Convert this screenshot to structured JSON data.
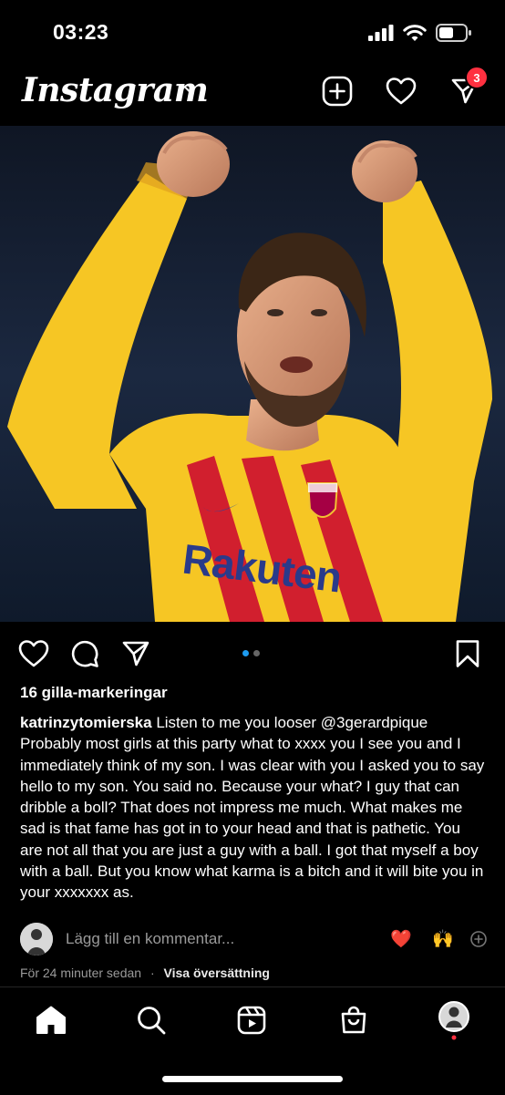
{
  "status_bar": {
    "time": "03:23"
  },
  "header": {
    "logo_text": "Instagram",
    "notification_count": "3"
  },
  "post": {
    "likes": "16 gilla-markeringar",
    "caption_user": "katrinzytomierska",
    "caption_text": "Listen to me you looser @3gerardpique Probably most girls at this party what to xxxx you I see you and I immediately think of my son. I was clear with you I asked you to say hello to my son. You said no. Because your what? I guy that can dribble a boll? That does not impress me much. What makes me sad is that fame has got in to your head and that is pathetic. You are not all that you are just a guy with a ball. I got that myself a boy with a ball. But you know what karma is a bitch and it will bite you in your xxxxxxx as.",
    "image_sponsor_text": "Rakuten",
    "carousel": {
      "total": 2,
      "active": 1
    },
    "comment_placeholder": "Lägg till en kommentar...",
    "quick_reactions": [
      "❤️",
      "🙌"
    ],
    "timestamp": "För 24 minuter sedan",
    "separator": "·",
    "translate_label": "Visa översättning"
  },
  "icons": {
    "header": [
      "new-post-icon",
      "heart-icon",
      "direct-message-icon"
    ],
    "actions": [
      "like-icon",
      "comment-icon",
      "share-icon",
      "save-icon"
    ],
    "nav": [
      "home-icon",
      "search-icon",
      "reels-icon",
      "shop-icon",
      "profile-avatar"
    ]
  },
  "colors": {
    "background": "#000000",
    "badge": "#ff3040",
    "carousel_active": "#1d9bf0",
    "jersey_yellow": "#f6c624",
    "jersey_red": "#d11f2e"
  }
}
